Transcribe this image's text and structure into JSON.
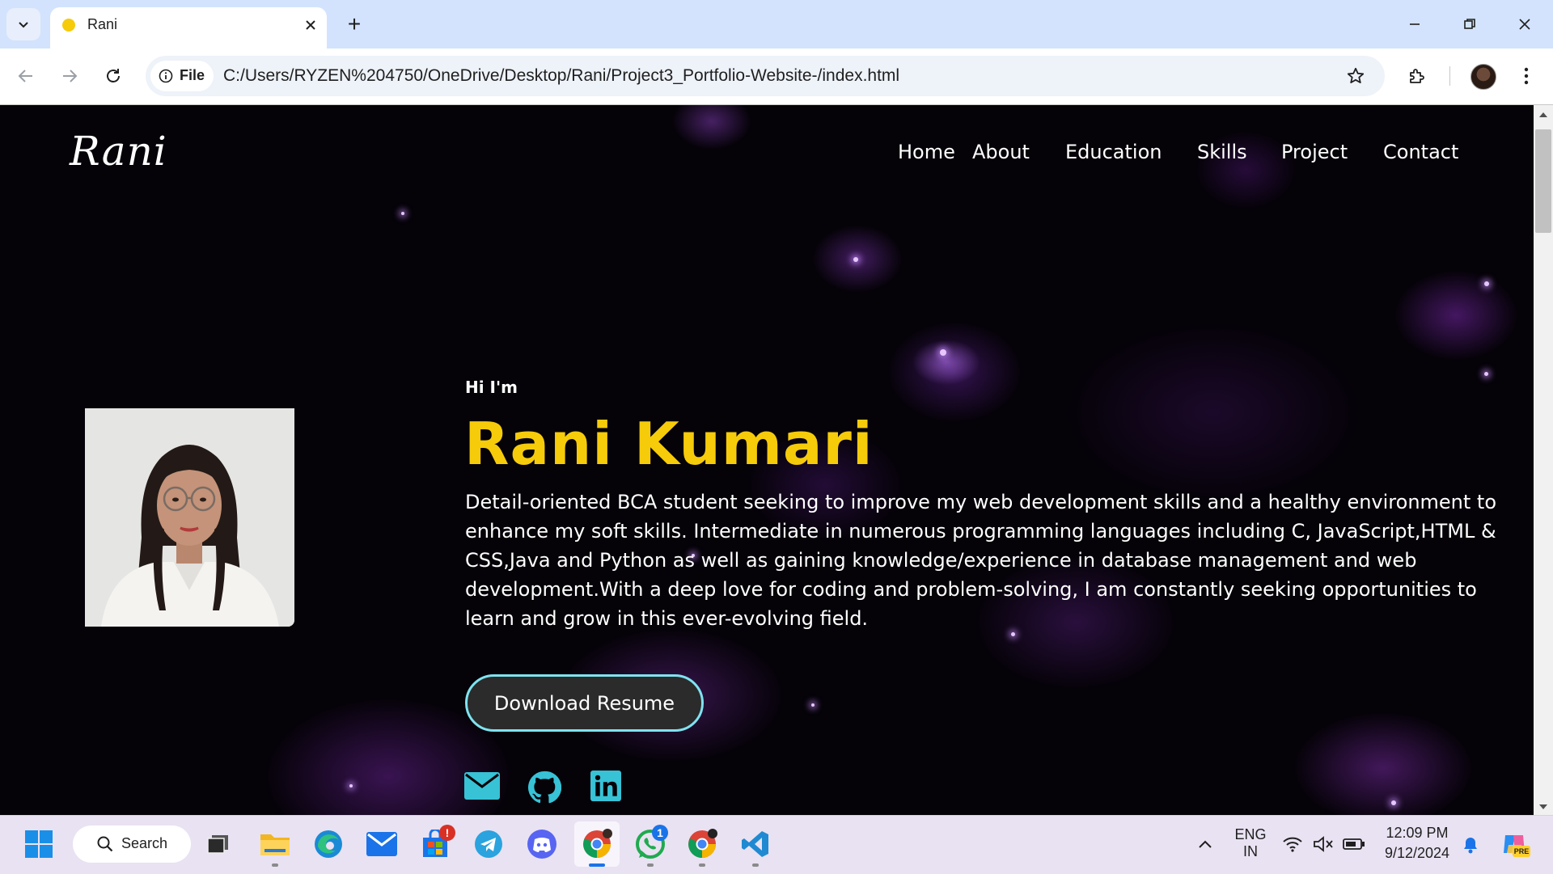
{
  "browser": {
    "tab_title": "Rani",
    "new_tab_label": "+",
    "site_chip_label": "File",
    "url": "C:/Users/RYZEN%204750/OneDrive/Desktop/Rani/Project3_Portfolio-Website-/index.html"
  },
  "site": {
    "logo": "Rani",
    "nav": [
      "Home",
      "About",
      "Education",
      "Skills",
      "Project",
      "Contact"
    ]
  },
  "hero": {
    "greeting": "Hi I'm",
    "name": "Rani Kumari",
    "bio": "Detail-oriented BCA student seeking to improve my web development skills and a healthy environment to enhance my soft skills. Intermediate in numerous programming languages including C, JavaScript,HTML & CSS,Java and Python as well as gaining knowledge/experience in database management and web development.With a deep love for coding and problem-solving, I am constantly seeking opportunities to learn and grow in this ever-evolving field.",
    "resume_button": "Download Resume",
    "socials": [
      "email-icon",
      "github-icon",
      "linkedin-icon"
    ]
  },
  "colors": {
    "name_accent": "#f6cb0a",
    "button_border": "#7fe3f0",
    "social_icon": "#37c2d6"
  },
  "taskbar": {
    "search_label": "Search",
    "lang_line1": "ENG",
    "lang_line2": "IN",
    "time": "12:09 PM",
    "date": "9/12/2024",
    "mail_badge": "!",
    "whatsapp_badge": "1",
    "copilot_badge": "PRE"
  }
}
